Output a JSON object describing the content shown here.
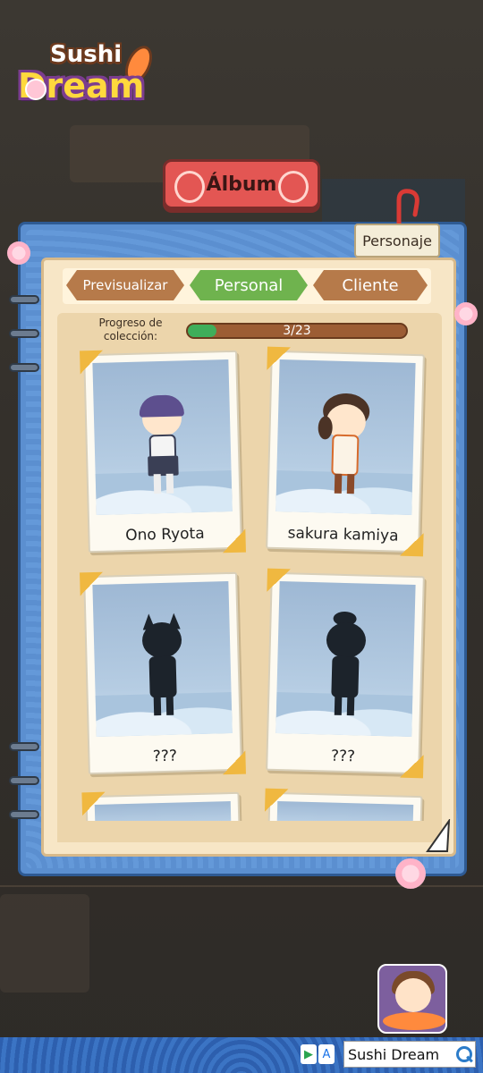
{
  "logo": {
    "line1": "Sushi",
    "line2": "Dream"
  },
  "header": {
    "title": "Álbum"
  },
  "side_tabs": [
    {
      "label": "Personaje"
    }
  ],
  "tabs": [
    {
      "label": "Previsualizar",
      "active": false
    },
    {
      "label": "Personal",
      "active": true
    },
    {
      "label": "Cliente",
      "active": false
    }
  ],
  "progress": {
    "label": "Progreso de colección:",
    "text": "3/23",
    "value": 0.13
  },
  "cards": [
    {
      "name": "Ono Ryota",
      "locked": false
    },
    {
      "name": "sakura kamiya",
      "locked": false
    },
    {
      "name": "???",
      "locked": true
    },
    {
      "name": "???",
      "locked": true
    }
  ],
  "banner": {
    "play_glyph": "▶",
    "store_glyph": "A",
    "search_text": "Sushi Dream"
  },
  "colors": {
    "tab_active": "#6fb34e",
    "tab_inactive": "#b67a4a",
    "album_banner": "#e35653",
    "book_blue": "#5b8fd0",
    "progress_fill": "#3fae5a"
  }
}
